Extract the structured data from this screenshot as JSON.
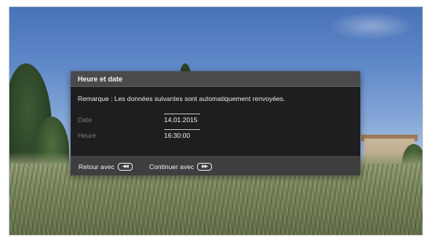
{
  "dialog": {
    "title": "Heure et date",
    "remark": "Remarque : Les données suivantes sont automatiquement renvoyées.",
    "fields": [
      {
        "label": "Date",
        "value": "14.01.2015"
      },
      {
        "label": "Heure",
        "value": "16:30:00"
      }
    ],
    "footer": {
      "back_label": "Retour avec",
      "back_icon": "rewind-key-icon",
      "back_glyph": "◀◀",
      "continue_label": "Continuer avec",
      "continue_icon": "fast-forward-key-icon",
      "continue_glyph": "▶▶"
    }
  },
  "colors": {
    "dialog_background": "#1e1e20",
    "dialog_header": "#4a4a4c",
    "dialog_footer": "#3e3e40",
    "label_color": "#7c7c80",
    "text_color": "#f0f0f0"
  }
}
